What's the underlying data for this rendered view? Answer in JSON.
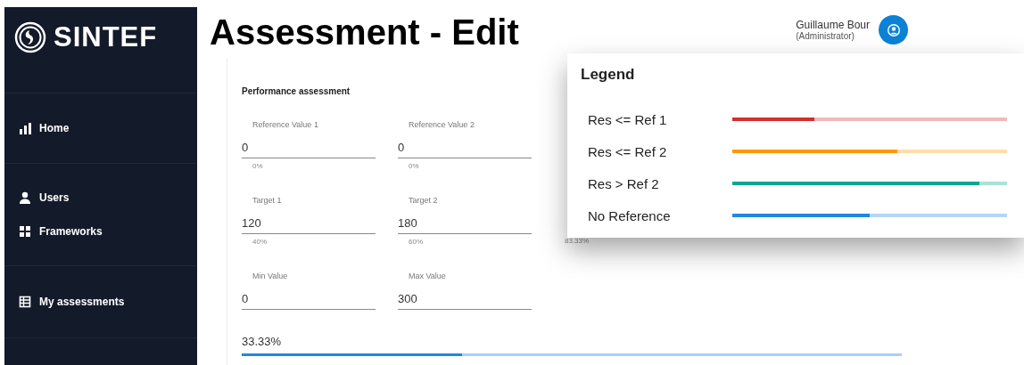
{
  "sidebar": {
    "logo": "SINTEF",
    "groups": [
      [
        {
          "label": "Home"
        }
      ],
      [
        {
          "label": "Users"
        },
        {
          "label": "Frameworks"
        }
      ],
      [
        {
          "label": "My assessments"
        }
      ]
    ]
  },
  "header": {
    "title": "Assessment - Edit",
    "user": {
      "name": "Guillaume Bour",
      "role": "(Administrator)"
    }
  },
  "section": {
    "title": "Performance assessment",
    "rows": [
      [
        {
          "label": "Reference Value 1",
          "value": "0",
          "hint": "0%"
        },
        {
          "label": "Reference Value 2",
          "value": "0",
          "hint": "0%"
        }
      ],
      [
        {
          "label": "Target 1",
          "value": "120",
          "hint": "40%"
        },
        {
          "label": "Target 2",
          "value": "180",
          "hint": "60%"
        },
        {
          "hint": "83.33%"
        }
      ],
      [
        {
          "label": "Min Value",
          "value": "0"
        },
        {
          "label": "Max Value",
          "value": "300"
        }
      ]
    ],
    "progress": {
      "reading": "33.33%",
      "level": 0.3333
    }
  },
  "legend": {
    "title": "Legend",
    "items": [
      {
        "label": "Res <= Ref 1",
        "color": "#d32f2f",
        "level": 0.3
      },
      {
        "label": "Res <= Ref 2",
        "color": "#ff9800",
        "level": 0.6
      },
      {
        "label": "Res > Ref 2",
        "color": "#00a88e",
        "level": 0.9
      },
      {
        "label": "No Reference",
        "color": "#1e88e5",
        "level": 0.5
      }
    ]
  }
}
